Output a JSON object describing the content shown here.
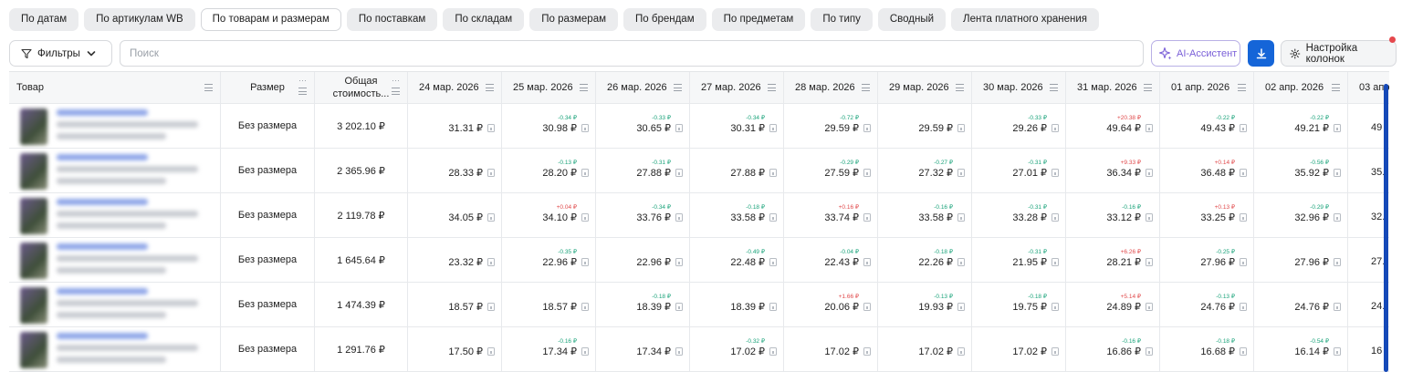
{
  "tabs": [
    "По датам",
    "По артикулам WB",
    "По товарам и размерам",
    "По поставкам",
    "По складам",
    "По размерам",
    "По брендам",
    "По предметам",
    "По типу",
    "Сводный",
    "Лента платного хранения"
  ],
  "active_tab_index": 2,
  "toolbar": {
    "filters_label": "Фильтры",
    "search_placeholder": "Поиск",
    "search_value": "",
    "ai_label": "AI-Ассистент",
    "columns_label": "Настройка колонок"
  },
  "table": {
    "columns": {
      "product": "Товар",
      "size": "Размер",
      "total_line1": "Общая",
      "total_line2": "стоимость...",
      "dates": [
        "24 мар. 2026",
        "25 мар. 2026",
        "26 мар. 2026",
        "27 мар. 2026",
        "28 мар. 2026",
        "29 мар. 2026",
        "30 мар. 2026",
        "31 мар. 2026",
        "01 апр. 2026",
        "02 апр. 2026",
        "03 апр"
      ]
    },
    "rows": [
      {
        "size": "Без размера",
        "total": "3 202.10 ₽",
        "cells": [
          {
            "price": "31.31 ₽",
            "delta": ""
          },
          {
            "price": "30.98 ₽",
            "delta": "-0.34 ₽"
          },
          {
            "price": "30.65 ₽",
            "delta": "-0.33 ₽"
          },
          {
            "price": "30.31 ₽",
            "delta": "-0.34 ₽"
          },
          {
            "price": "29.59 ₽",
            "delta": "-0.72 ₽"
          },
          {
            "price": "29.59 ₽",
            "delta": ""
          },
          {
            "price": "29.26 ₽",
            "delta": "-0.33 ₽"
          },
          {
            "price": "49.64 ₽",
            "delta": "+20.38 ₽"
          },
          {
            "price": "49.43 ₽",
            "delta": "-0.22 ₽"
          },
          {
            "price": "49.21 ₽",
            "delta": "-0.22 ₽"
          },
          {
            "price": "49",
            "delta": ""
          }
        ]
      },
      {
        "size": "Без размера",
        "total": "2 365.96 ₽",
        "cells": [
          {
            "price": "28.33 ₽",
            "delta": ""
          },
          {
            "price": "28.20 ₽",
            "delta": "-0.13 ₽"
          },
          {
            "price": "27.88 ₽",
            "delta": "-0.31 ₽"
          },
          {
            "price": "27.88 ₽",
            "delta": ""
          },
          {
            "price": "27.59 ₽",
            "delta": "-0.29 ₽"
          },
          {
            "price": "27.32 ₽",
            "delta": "-0.27 ₽"
          },
          {
            "price": "27.01 ₽",
            "delta": "-0.31 ₽"
          },
          {
            "price": "36.34 ₽",
            "delta": "+9.33 ₽"
          },
          {
            "price": "36.48 ₽",
            "delta": "+0.14 ₽"
          },
          {
            "price": "35.92 ₽",
            "delta": "-0.56 ₽"
          },
          {
            "price": "35.",
            "delta": ""
          }
        ]
      },
      {
        "size": "Без размера",
        "total": "2 119.78 ₽",
        "cells": [
          {
            "price": "34.05 ₽",
            "delta": ""
          },
          {
            "price": "34.10 ₽",
            "delta": "+0.04 ₽"
          },
          {
            "price": "33.76 ₽",
            "delta": "-0.34 ₽"
          },
          {
            "price": "33.58 ₽",
            "delta": "-0.18 ₽"
          },
          {
            "price": "33.74 ₽",
            "delta": "+0.16 ₽"
          },
          {
            "price": "33.58 ₽",
            "delta": "-0.16 ₽"
          },
          {
            "price": "33.28 ₽",
            "delta": "-0.31 ₽"
          },
          {
            "price": "33.12 ₽",
            "delta": "-0.16 ₽"
          },
          {
            "price": "33.25 ₽",
            "delta": "+0.13 ₽"
          },
          {
            "price": "32.96 ₽",
            "delta": "-0.29 ₽"
          },
          {
            "price": "32.",
            "delta": ""
          }
        ]
      },
      {
        "size": "Без размера",
        "total": "1 645.64 ₽",
        "cells": [
          {
            "price": "23.32 ₽",
            "delta": ""
          },
          {
            "price": "22.96 ₽",
            "delta": "-0.35 ₽"
          },
          {
            "price": "22.96 ₽",
            "delta": ""
          },
          {
            "price": "22.48 ₽",
            "delta": "-0.49 ₽"
          },
          {
            "price": "22.43 ₽",
            "delta": "-0.04 ₽"
          },
          {
            "price": "22.26 ₽",
            "delta": "-0.18 ₽"
          },
          {
            "price": "21.95 ₽",
            "delta": "-0.31 ₽"
          },
          {
            "price": "28.21 ₽",
            "delta": "+6.26 ₽"
          },
          {
            "price": "27.96 ₽",
            "delta": "-0.25 ₽"
          },
          {
            "price": "27.96 ₽",
            "delta": ""
          },
          {
            "price": "27.",
            "delta": ""
          }
        ]
      },
      {
        "size": "Без размера",
        "total": "1 474.39 ₽",
        "cells": [
          {
            "price": "18.57 ₽",
            "delta": ""
          },
          {
            "price": "18.57 ₽",
            "delta": ""
          },
          {
            "price": "18.39 ₽",
            "delta": "-0.18 ₽"
          },
          {
            "price": "18.39 ₽",
            "delta": ""
          },
          {
            "price": "20.06 ₽",
            "delta": "+1.66 ₽"
          },
          {
            "price": "19.93 ₽",
            "delta": "-0.13 ₽"
          },
          {
            "price": "19.75 ₽",
            "delta": "-0.18 ₽"
          },
          {
            "price": "24.89 ₽",
            "delta": "+5.14 ₽"
          },
          {
            "price": "24.76 ₽",
            "delta": "-0.13 ₽"
          },
          {
            "price": "24.76 ₽",
            "delta": ""
          },
          {
            "price": "24.",
            "delta": ""
          }
        ]
      },
      {
        "size": "Без размера",
        "total": "1 291.76 ₽",
        "cells": [
          {
            "price": "17.50 ₽",
            "delta": ""
          },
          {
            "price": "17.34 ₽",
            "delta": "-0.16 ₽"
          },
          {
            "price": "17.34 ₽",
            "delta": ""
          },
          {
            "price": "17.02 ₽",
            "delta": "-0.32 ₽"
          },
          {
            "price": "17.02 ₽",
            "delta": ""
          },
          {
            "price": "17.02 ₽",
            "delta": ""
          },
          {
            "price": "17.02 ₽",
            "delta": ""
          },
          {
            "price": "16.86 ₽",
            "delta": "-0.16 ₽"
          },
          {
            "price": "16.68 ₽",
            "delta": "-0.18 ₽"
          },
          {
            "price": "16.14 ₽",
            "delta": "-0.54 ₽"
          },
          {
            "price": "16",
            "delta": ""
          }
        ]
      }
    ]
  },
  "colors": {
    "accent": "#1565d8",
    "delta_down": "#1aa37a",
    "delta_up": "#e0484a",
    "ai_purple": "#7a5fd8"
  }
}
